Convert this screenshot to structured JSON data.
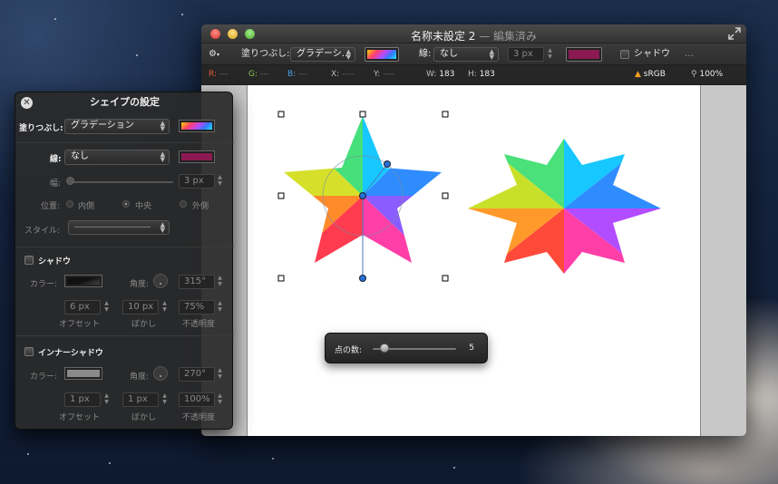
{
  "window": {
    "title": "名称未設定 2",
    "title_suffix": "— 編集済み"
  },
  "toolbar": {
    "fill_label": "塗りつぶし:",
    "fill_value": "グラデーシ…",
    "stroke_label": "線:",
    "stroke_value": "なし",
    "width_value": "3 px",
    "shadow_label": "シャドウ",
    "more": "…",
    "stroke_color": "#8b1a52"
  },
  "info": {
    "r_label": "R:",
    "r_value": "---",
    "g_label": "G:",
    "g_value": "---",
    "b_label": "B:",
    "b_value": "---",
    "x_label": "X:",
    "x_value": "----",
    "y_label": "Y:",
    "y_value": "----",
    "w_label": "W:",
    "w_value": "183",
    "h_label": "H:",
    "h_value": "183",
    "colorspace": "sRGB",
    "zoom": "100%"
  },
  "hud": {
    "label": "点の数:",
    "value": "5",
    "level": 0.05
  },
  "panel": {
    "title": "シェイプの設定",
    "fill_label": "塗りつぶし:",
    "fill_value": "グラデーション",
    "stroke_label": "線:",
    "stroke_value": "なし",
    "stroke_color": "#8b1a52",
    "width_label": "幅:",
    "width_value": "3 px",
    "position_label": "位置:",
    "position_inner": "内側",
    "position_center": "中央",
    "position_outer": "外側",
    "style_label": "スタイル:",
    "shadow_title": "シャドウ",
    "shadow_color_label": "カラー:",
    "shadow_angle_label": "角度:",
    "shadow_angle_value": "315°",
    "shadow_offset_value": "6 px",
    "shadow_blur_value": "10 px",
    "shadow_opacity_value": "75%",
    "offset_caption": "オフセット",
    "blur_caption": "ぼかし",
    "opacity_caption": "不透明度",
    "inner_title": "インナーシャドウ",
    "inner_color_label": "カラー:",
    "inner_angle_label": "角度:",
    "inner_angle_value": "270°",
    "inner_offset_value": "1 px",
    "inner_blur_value": "1 px",
    "inner_opacity_value": "100%",
    "inner_color": "#8a8a8a"
  }
}
